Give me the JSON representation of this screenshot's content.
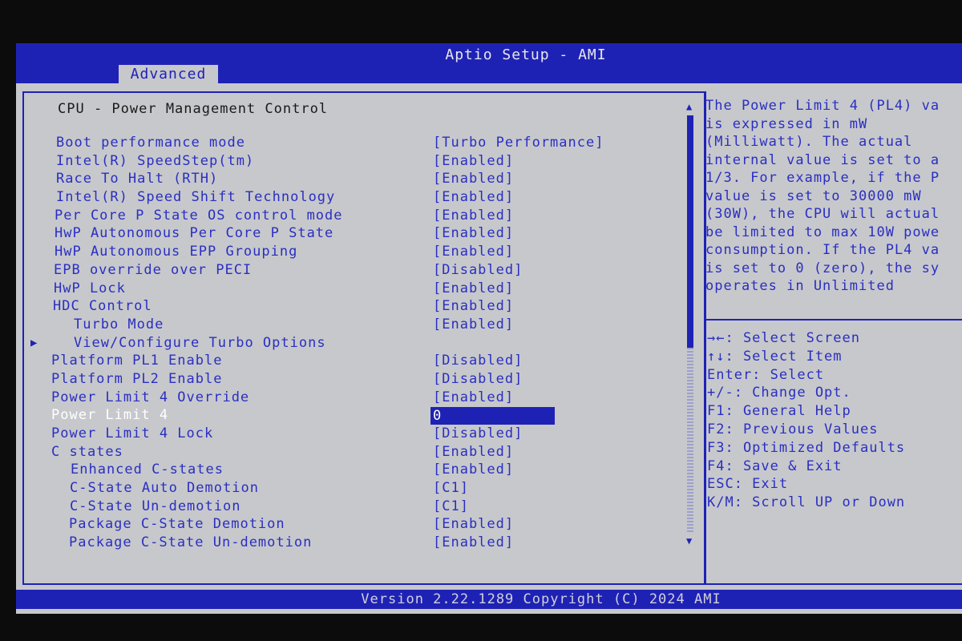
{
  "header": {
    "title": "Aptio Setup - AMI",
    "tab_label": "Advanced"
  },
  "section": {
    "heading": "CPU - Power Management Control"
  },
  "settings": [
    {
      "label": "Boot performance mode",
      "value": "[Turbo Performance]"
    },
    {
      "label": "Intel(R) SpeedStep(tm)",
      "value": "[Enabled]"
    },
    {
      "label": "Race To Halt (RTH)",
      "value": "[Enabled]"
    },
    {
      "label": "Intel(R) Speed Shift Technology",
      "value": "[Enabled]"
    },
    {
      "label": "Per Core P State OS control mode",
      "value": "[Enabled]"
    },
    {
      "label": "HwP Autonomous Per Core P State",
      "value": "[Enabled]"
    },
    {
      "label": "HwP Autonomous EPP Grouping",
      "value": "[Enabled]"
    },
    {
      "label": "EPB override over PECI",
      "value": "[Disabled]"
    },
    {
      "label": "HwP Lock",
      "value": "[Enabled]"
    },
    {
      "label": "HDC Control",
      "value": "[Enabled]"
    },
    {
      "label": "Turbo Mode",
      "value": "[Enabled]"
    },
    {
      "label": "View/Configure Turbo Options",
      "value": ""
    },
    {
      "label": "Platform PL1 Enable",
      "value": "[Disabled]"
    },
    {
      "label": "Platform PL2 Enable",
      "value": "[Disabled]"
    },
    {
      "label": "Power Limit 4 Override",
      "value": "[Enabled]"
    },
    {
      "label": "Power Limit 4",
      "value": "0"
    },
    {
      "label": "Power Limit 4 Lock",
      "value": "[Disabled]"
    },
    {
      "label": "C states",
      "value": "[Enabled]"
    },
    {
      "label": "Enhanced C-states",
      "value": "[Enabled]"
    },
    {
      "label": "C-State Auto Demotion",
      "value": "[C1]"
    },
    {
      "label": "C-State Un-demotion",
      "value": "[C1]"
    },
    {
      "label": "Package C-State Demotion",
      "value": "[Enabled]"
    },
    {
      "label": "Package C-State Un-demotion",
      "value": "[Enabled]"
    }
  ],
  "help_text": [
    "The Power Limit 4 (PL4) va",
    "is expressed in mW",
    "(Milliwatt). The actual",
    "internal value is set to a",
    "1/3. For example, if the P",
    "value is set to 30000 mW",
    "(30W), the CPU will actual",
    "be limited to max 10W powe",
    "consumption. If the PL4 va",
    "is set to 0 (zero), the sy",
    "operates in Unlimited"
  ],
  "key_help": [
    "→←: Select Screen",
    "↑↓: Select Item",
    "Enter: Select",
    "+/-: Change Opt.",
    "F1: General Help",
    "F2: Previous Values",
    "F3: Optimized Defaults",
    "F4: Save & Exit",
    "ESC: Exit",
    "K/M: Scroll UP or Down"
  ],
  "footer": {
    "text": "Version 2.22.1289 Copyright (C) 2024 AMI"
  },
  "icons": {
    "submenu": "submenu-arrow-icon",
    "scroll_up": "scroll-up-icon",
    "scroll_down": "scroll-down-icon"
  },
  "colors": {
    "bios_blue": "#1e22b4",
    "panel_grey": "#c7c8cc",
    "text_blue": "#2a2fc0"
  }
}
